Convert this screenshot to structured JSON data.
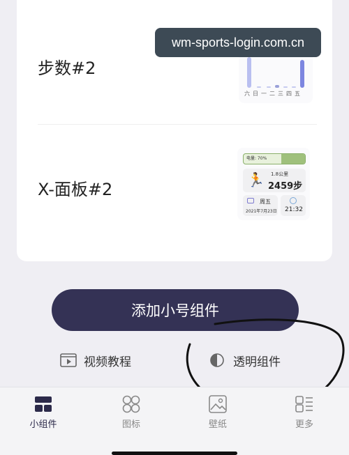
{
  "watermark": "wm-sports-login.com.cn",
  "widgets": [
    {
      "title": "步数#2",
      "preview": {
        "weekdays": "六日一二三四五"
      }
    },
    {
      "title": "X-面板#2",
      "preview": {
        "battery": "电量: 70%",
        "distance": "1.8公里",
        "steps": "2459步",
        "weekday": "周五",
        "date": "2021年7月23日",
        "time": "21:32"
      }
    }
  ],
  "add_button": "添加小号组件",
  "links": {
    "video": "视频教程",
    "transparent": "透明组件"
  },
  "tabs": [
    {
      "label": "小组件",
      "icon": "widgets-icon",
      "active": true
    },
    {
      "label": "图标",
      "icon": "icons-grid-icon",
      "active": false
    },
    {
      "label": "壁纸",
      "icon": "wallpaper-icon",
      "active": false
    },
    {
      "label": "更多",
      "icon": "more-icon",
      "active": false
    }
  ],
  "colors": {
    "primary": "#343255",
    "background": "#efeef3",
    "card": "#ffffff"
  }
}
